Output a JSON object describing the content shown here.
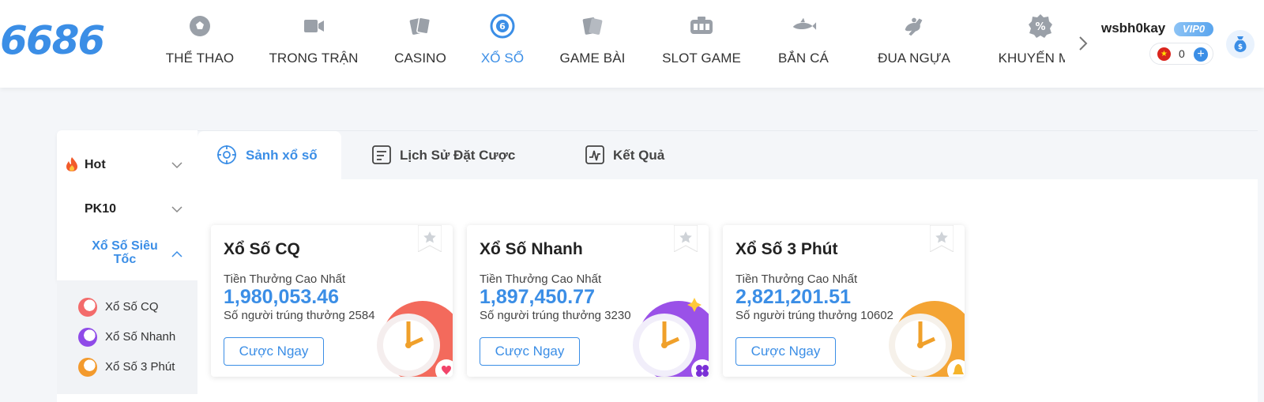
{
  "logo": {
    "text": "6686"
  },
  "nav": {
    "items": [
      {
        "label": "THỂ THAO",
        "icon": "soccer-ball-icon"
      },
      {
        "label": "TRONG TRẬN",
        "icon": "video-camera-icon"
      },
      {
        "label": "CASINO",
        "icon": "playing-cards-icon"
      },
      {
        "label": "XỔ SỐ",
        "icon": "lottery-ball-icon",
        "active": true
      },
      {
        "label": "GAME BÀI",
        "icon": "card-game-icon"
      },
      {
        "label": "SLOT GAME",
        "icon": "slot-machine-icon"
      },
      {
        "label": "BẮN CÁ",
        "icon": "fish-icon"
      },
      {
        "label": "ĐUA NGỰA",
        "icon": "horse-racing-icon"
      },
      {
        "label": "KHUYẾN MÃI",
        "icon": "discount-icon"
      }
    ]
  },
  "user": {
    "name": "wsbh0kay",
    "vip": "VIP0",
    "balance": "0"
  },
  "sidebar": {
    "categories": [
      {
        "label": "Hot",
        "icon": "fire-icon",
        "expanded": false
      },
      {
        "label": "PK10",
        "expanded": false
      },
      {
        "label": "Xổ Số Siêu Tốc",
        "expanded": true
      }
    ],
    "sub_items": [
      {
        "label": "Xổ Số CQ",
        "color": "#f36b6b"
      },
      {
        "label": "Xổ Số Nhanh",
        "color": "#8f4be8"
      },
      {
        "label": "Xổ Số 3 Phút",
        "color": "#f39a2d"
      }
    ]
  },
  "tabs": [
    {
      "label": "Sảnh xổ số",
      "icon": "target-icon",
      "active": true
    },
    {
      "label": "Lịch Sử Đặt Cược",
      "icon": "history-list-icon"
    },
    {
      "label": "Kết Quả",
      "icon": "result-chart-icon"
    }
  ],
  "cards": [
    {
      "title": "Xổ Số CQ",
      "prize_label": "Tiền Thưởng Cao Nhất",
      "prize": "1,980,053.46",
      "winners": "Số người trúng thưởng 2584",
      "button": "Cược Ngay",
      "theme_color": "#f25a4a",
      "badge_icon": "heart-icon"
    },
    {
      "title": "Xổ Số Nhanh",
      "prize_label": "Tiền Thưởng Cao Nhất",
      "prize": "1,897,450.77",
      "winners": "Số người trúng thưởng 3230",
      "button": "Cược Ngay",
      "theme_color": "#8f3ee6",
      "badge_icon": "clover-icon"
    },
    {
      "title": "Xổ Số 3 Phút",
      "prize_label": "Tiền Thưởng Cao Nhất",
      "prize": "2,821,201.51",
      "winners": "Số người trúng thưởng 10602",
      "button": "Cược Ngay",
      "theme_color": "#f39a1e",
      "badge_icon": "bell-icon"
    }
  ],
  "colors": {
    "accent": "#3b8ee6",
    "text": "#333333"
  }
}
